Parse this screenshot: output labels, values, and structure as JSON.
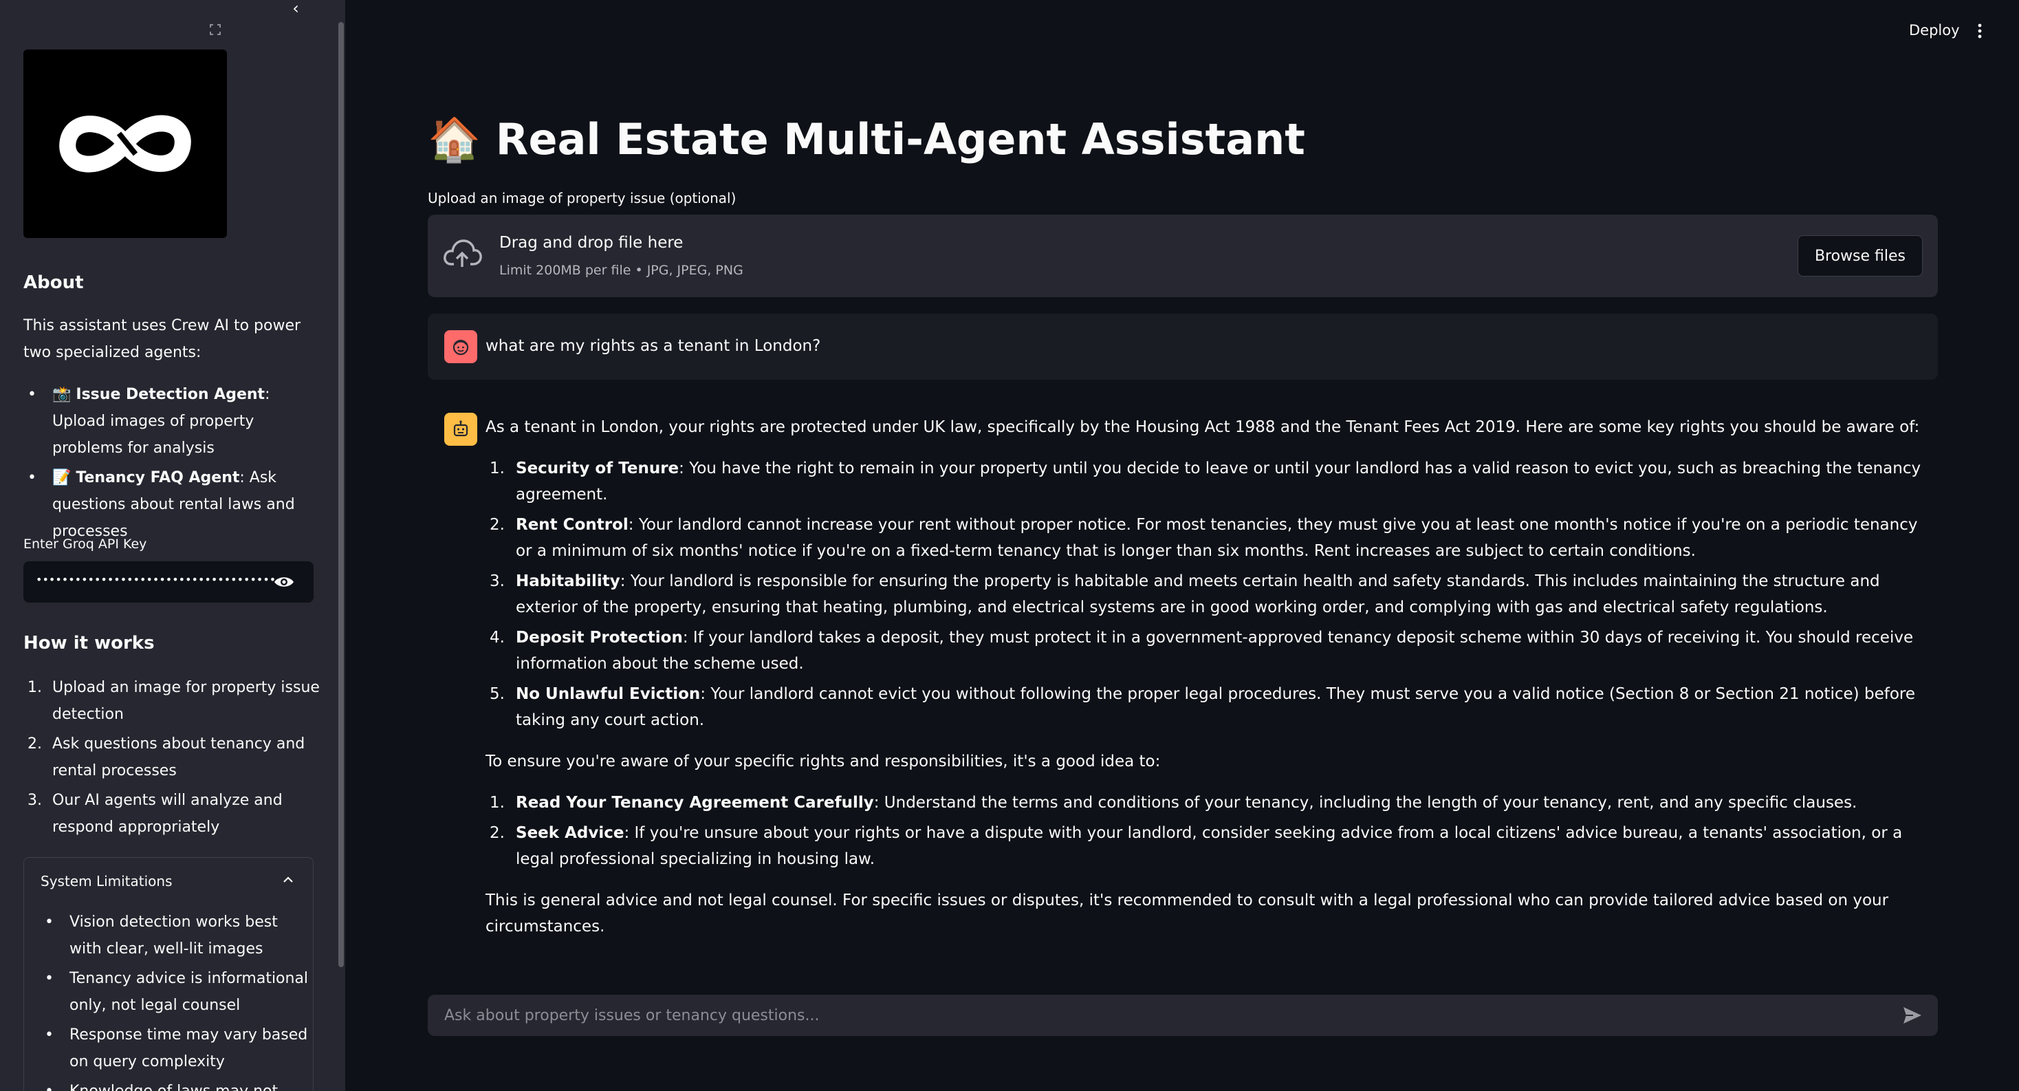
{
  "sidebar": {
    "about_title": "About",
    "about_text": "This assistant uses Crew AI to power two specialized agents:",
    "agents": [
      {
        "icon": "📸",
        "name": "Issue Detection Agent",
        "desc": ": Upload images of property problems for analysis"
      },
      {
        "icon": "📝",
        "name": "Tenancy FAQ Agent",
        "desc": ": Ask questions about rental laws and processes"
      }
    ],
    "api_label": "Enter Groq API Key",
    "api_value": "••••••••••••••••••••••••••••••••••••••••••••••••••••••••",
    "how_title": "How it works",
    "steps": [
      {
        "n": "1.",
        "text": "Upload an image for property issue detection"
      },
      {
        "n": "2.",
        "text": "Ask questions about tenancy and rental processes"
      },
      {
        "n": "3.",
        "text": "Our AI agents will analyze and respond appropriately"
      }
    ],
    "limitations_title": "System Limitations",
    "limitations": [
      "Vision detection works best with clear, well-lit images",
      "Tenancy advice is informational only, not legal counsel",
      "Response time may vary based on query complexity",
      "Knowledge of laws may not"
    ]
  },
  "header": {
    "deploy_label": "Deploy"
  },
  "main": {
    "title": "🏠 Real Estate Multi-Agent Assistant",
    "upload_label": "Upload an image of property issue (optional)",
    "drop_text": "Drag and drop file here",
    "limit_text": "Limit 200MB per file • JPG, JPEG, PNG",
    "browse_label": "Browse files",
    "user_message": "what are my rights as a tenant in London?",
    "reply": {
      "intro": "As a tenant in London, your rights are protected under UK law, specifically by the Housing Act 1988 and the Tenant Fees Act 2019. Here are some key rights you should be aware of:",
      "rights": [
        {
          "n": "1.",
          "title": "Security of Tenure",
          "text": ": You have the right to remain in your property until you decide to leave or until your landlord has a valid reason to evict you, such as breaching the tenancy agreement."
        },
        {
          "n": "2.",
          "title": "Rent Control",
          "text": ": Your landlord cannot increase your rent without proper notice. For most tenancies, they must give you at least one month's notice if you're on a periodic tenancy or a minimum of six months' notice if you're on a fixed-term tenancy that is longer than six months. Rent increases are subject to certain conditions."
        },
        {
          "n": "3.",
          "title": "Habitability",
          "text": ": Your landlord is responsible for ensuring the property is habitable and meets certain health and safety standards. This includes maintaining the structure and exterior of the property, ensuring that heating, plumbing, and electrical systems are in good working order, and complying with gas and electrical safety regulations."
        },
        {
          "n": "4.",
          "title": "Deposit Protection",
          "text": ": If your landlord takes a deposit, they must protect it in a government-approved tenancy deposit scheme within 30 days of receiving it. You should receive information about the scheme used."
        },
        {
          "n": "5.",
          "title": "No Unlawful Eviction",
          "text": ": Your landlord cannot evict you without following the proper legal procedures. They must serve you a valid notice (Section 8 or Section 21 notice) before taking any court action."
        }
      ],
      "middle": "To ensure you're aware of your specific rights and responsibilities, it's a good idea to:",
      "tips": [
        {
          "n": "1.",
          "title": "Read Your Tenancy Agreement Carefully",
          "text": ": Understand the terms and conditions of your tenancy, including the length of your tenancy, rent, and any specific clauses."
        },
        {
          "n": "2.",
          "title": "Seek Advice",
          "text": ": If you're unsure about your rights or have a dispute with your landlord, consider seeking advice from a local citizens' advice bureau, a tenants' association, or a legal professional specializing in housing law."
        }
      ],
      "outro": "This is general advice and not legal counsel. For specific issues or disputes, it's recommended to consult with a legal professional who can provide tailored advice based on your circumstances."
    },
    "chat_placeholder": "Ask about property issues or tenancy questions..."
  },
  "icons": {
    "collapse": "chevron-left-icon",
    "expand": "expand-icon",
    "logo": "infinity-logo",
    "eye": "eye-icon",
    "upload": "cloud-upload-icon",
    "user_avatar": "user-avatar-icon",
    "bot_avatar": "bot-avatar-icon",
    "send": "send-icon",
    "menu": "kebab-menu-icon"
  },
  "colors": {
    "background": "#0e1117",
    "sidebar": "#262730",
    "user_avatar": "#ff6b6b",
    "bot_avatar": "#ffbd45"
  }
}
